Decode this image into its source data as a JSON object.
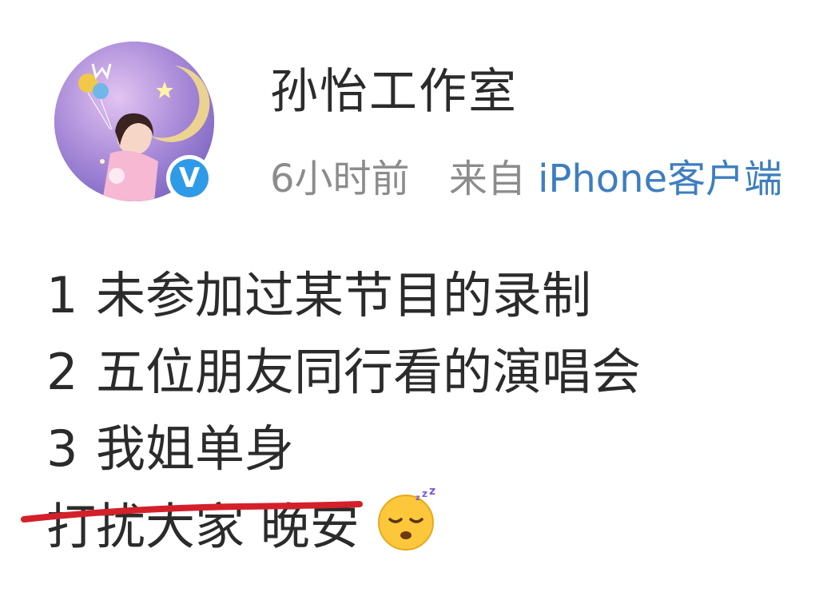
{
  "post": {
    "account_name": "孙怡工作室",
    "time": "6小时前",
    "source_prefix": "来自",
    "source_client": "iPhone客户端",
    "lines": [
      {
        "num": "1",
        "text": "未参加过某节目的录制"
      },
      {
        "num": "2",
        "text": "五位朋友同行看的演唱会"
      },
      {
        "num": "3",
        "text": "我姐单身"
      }
    ],
    "closing": "打扰大家 晚安",
    "emoji": "sleeping-face",
    "verified_mark": "V"
  },
  "colors": {
    "verified_blue": "#2f9be8",
    "client_link": "#3d7ebf",
    "annotation_red": "#d4202a"
  }
}
